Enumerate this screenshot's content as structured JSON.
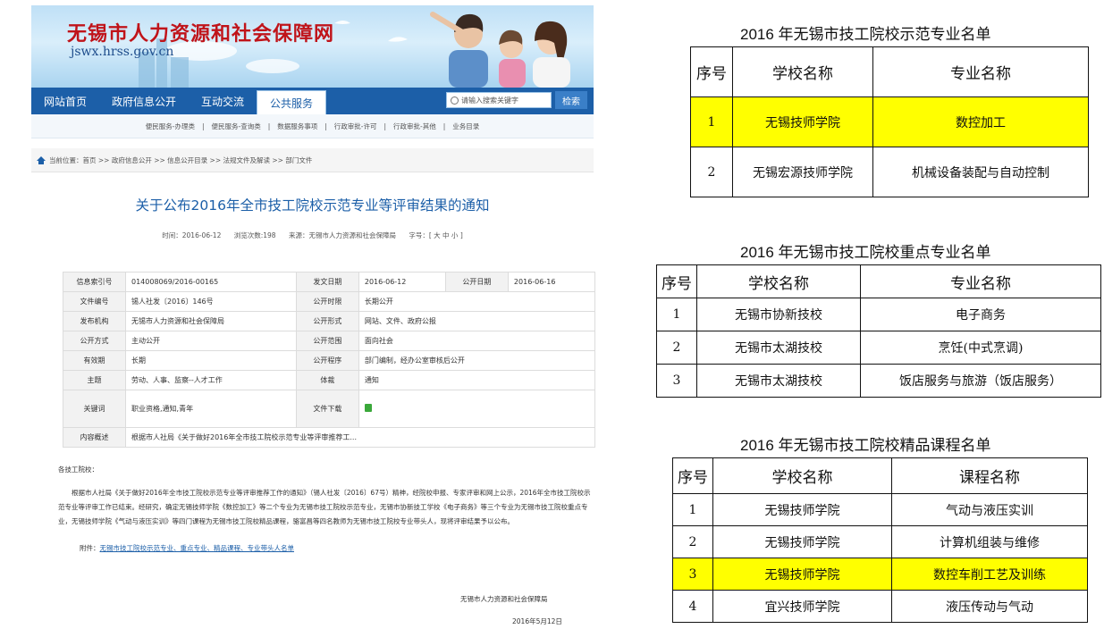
{
  "site": {
    "title": "无锡市人力资源和社会保障网",
    "domain": "jswx.hrss.gov.cn",
    "nav": [
      "网站首页",
      "政府信息公开",
      "互动交流",
      "公共服务"
    ],
    "search_placeholder": "请输入搜索关键字",
    "search_button": "检索",
    "subnav": [
      "便民服务-办理类",
      "|",
      "便民服务-查询类",
      "|",
      "数据服务事项",
      "|",
      "行政审批-许可",
      "|",
      "行政审批-其他",
      "|",
      "业务目录"
    ],
    "breadcrumb": "当前位置：首页 >> 政府信息公开 >> 信息公开目录 >> 法规文件及解读 >> 部门文件"
  },
  "article": {
    "title": "关于公布2016年全市技工院校示范专业等评审结果的通知",
    "meta": {
      "time": "时间：2016-06-12",
      "views": "浏览次数:198",
      "source": "来源：无锡市人力资源和社会保障局",
      "fontsize": "字号：[ 大 中 小 ]"
    },
    "info": {
      "r1": [
        "信息索引号",
        "014008069/2016-00165",
        "发文日期",
        "2016-06-12",
        "公开日期",
        "2016-06-16"
      ],
      "r2": [
        "文件编号",
        "锡人社发〔2016〕146号",
        "公开时限",
        "长期公开"
      ],
      "r3": [
        "发布机构",
        "无锡市人力资源和社会保障局",
        "公开形式",
        "网站、文件、政府公报"
      ],
      "r4": [
        "公开方式",
        "主动公开",
        "公开范围",
        "面向社会"
      ],
      "r5": [
        "有效期",
        "长期",
        "公开程序",
        "部门编制，经办公室审核后公开"
      ],
      "r6": [
        "主题",
        "劳动、人事、监察--人才工作",
        "体裁",
        "通知"
      ],
      "r7": [
        "关键词",
        "职业资格,通知,青年",
        "文件下载"
      ],
      "r8": [
        "内容概述",
        "根据市人社局《关于做好2016年全市技工院校示范专业等评审推荐工..."
      ]
    },
    "greeting": "各技工院校：",
    "paragraph": "根据市人社局《关于做好2016年全市技工院校示范专业等评审推荐工作的通知》（锡人社发〔2016〕67号）精神，经院校申报、专家评审和网上公示，2016年全市技工院校示范专业等评审工作已结束。经研究，确定无锡技师学院《数控加工》等二个专业为无锡市技工院校示范专业，无锡市协新技工学校《电子商务》等三个专业为无锡市技工院校重点专业，无锡技师学院《气动与液压实训》等四门课程为无锡市技工院校精品课程，骆富昌等四名教师为无锡市技工院校专业带头人，现将评审结果予以公布。",
    "attach_label": "附件：",
    "attach_link": "无锡市技工院校示范专业、重点专业、精品课程、专业带头人名单",
    "sign_org": "无锡市人力资源和社会保障局",
    "sign_date": "2016年5月12日"
  },
  "tables": {
    "demo": {
      "title": "2016 年无锡市技工院校示范专业名单",
      "headers": [
        "序号",
        "学校名称",
        "专业名称"
      ],
      "rows": [
        [
          "1",
          "无锡技师学院",
          "数控加工"
        ],
        [
          "2",
          "无锡宏源技师学院",
          "机械设备装配与自动控制"
        ]
      ]
    },
    "key": {
      "title": "2016 年无锡市技工院校重点专业名单",
      "headers": [
        "序号",
        "学校名称",
        "专业名称"
      ],
      "rows": [
        [
          "1",
          "无锡市协新技校",
          "电子商务"
        ],
        [
          "2",
          "无锡市太湖技校",
          "烹饪(中式烹调)"
        ],
        [
          "3",
          "无锡市太湖技校",
          "饭店服务与旅游（饭店服务）"
        ]
      ]
    },
    "course": {
      "title": "2016 年无锡市技工院校精品课程名单",
      "headers": [
        "序号",
        "学校名称",
        "课程名称"
      ],
      "rows": [
        [
          "1",
          "无锡技师学院",
          "气动与液压实训"
        ],
        [
          "2",
          "无锡技师学院",
          "计算机组装与维修"
        ],
        [
          "3",
          "无锡技师学院",
          "数控车削工艺及训练"
        ],
        [
          "4",
          "宜兴技师学院",
          "液压传动与气动"
        ]
      ]
    }
  },
  "colors": {
    "nav_blue": "#1c5fa8",
    "title_red": "#c0141a",
    "highlight_yellow": "#ffff00"
  }
}
